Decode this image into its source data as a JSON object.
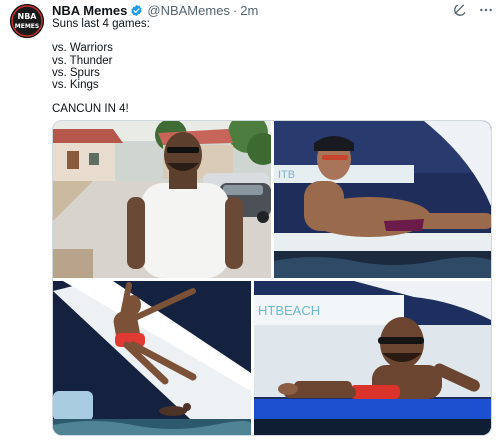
{
  "tweet": {
    "author_name": "NBA Memes",
    "handle": "@NBAMemes",
    "separator": "·",
    "time": "2m",
    "avatar_text_top": "NBA",
    "avatar_text_bottom": "MEMES",
    "lines": [
      "Suns last 4 games:",
      "",
      "vs. Warriors",
      "vs. Thunder",
      "vs. Spurs",
      "vs. Kings",
      "",
      "CANCUN IN 4!"
    ],
    "photo4_sign": "HTBEACH",
    "photo2_sign": "ITB"
  },
  "icons": {
    "verified": "verified-badge-icon",
    "grok": "grok-icon",
    "more": "more-dots-icon"
  },
  "colors": {
    "verified_blue": "#1d9bf0",
    "muted": "#536471",
    "text": "#0f1419"
  }
}
